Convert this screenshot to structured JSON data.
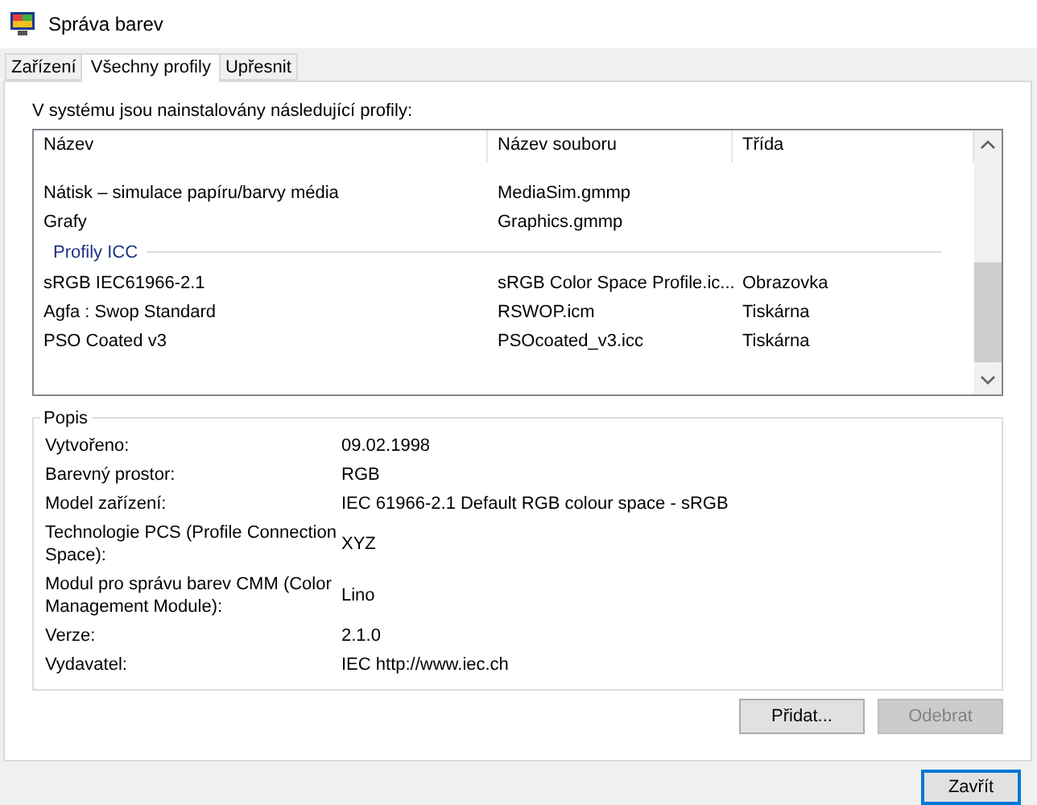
{
  "window": {
    "title": "Správa barev"
  },
  "tabs": [
    {
      "label": "Zařízení",
      "selected": false
    },
    {
      "label": "Všechny profily",
      "selected": true
    },
    {
      "label": "Upřesnit",
      "selected": false
    }
  ],
  "profiles": {
    "caption": "V systému jsou nainstalovány následující profily:",
    "columns": [
      "Název",
      "Název souboru",
      "Třída"
    ],
    "rows": [
      {
        "kind": "row",
        "cells": [
          "Nátisk – simulace papíru/barvy média",
          "MediaSim.gmmp"
        ]
      },
      {
        "kind": "row",
        "cells": [
          "Grafy",
          "Graphics.gmmp"
        ]
      },
      {
        "kind": "group",
        "label": "Profily ICC"
      },
      {
        "kind": "row",
        "cells": [
          "sRGB IEC61966-2.1",
          "sRGB Color Space Profile.ic...",
          "Obrazovka"
        ]
      },
      {
        "kind": "row",
        "cells": [
          "Agfa : Swop Standard",
          "RSWOP.icm",
          "Tiskárna"
        ]
      },
      {
        "kind": "row",
        "cells": [
          "PSO Coated v3",
          "PSOcoated_v3.icc",
          "Tiskárna"
        ]
      }
    ]
  },
  "description": {
    "title": "Popis",
    "fields": [
      {
        "label": "Vytvořeno:",
        "value": "09.02.1998"
      },
      {
        "label": "Barevný prostor:",
        "value": "RGB"
      },
      {
        "label": "Model zařízení:",
        "value": "IEC 61966-2.1 Default RGB colour space - sRGB"
      },
      {
        "label": "Technologie PCS (Profile Connection Space):",
        "value": "XYZ"
      },
      {
        "label": "Modul pro správu barev CMM (Color Management Module):",
        "value": "Lino"
      },
      {
        "label": "Verze:",
        "value": "2.1.0"
      },
      {
        "label": "Vydavatel:",
        "value": "IEC http://www.iec.ch"
      }
    ]
  },
  "buttons": [
    {
      "label": "Přidat...",
      "disabled": false
    },
    {
      "label": "Odebrat",
      "disabled": true
    }
  ],
  "close_button": {
    "label": "Zavřít"
  }
}
